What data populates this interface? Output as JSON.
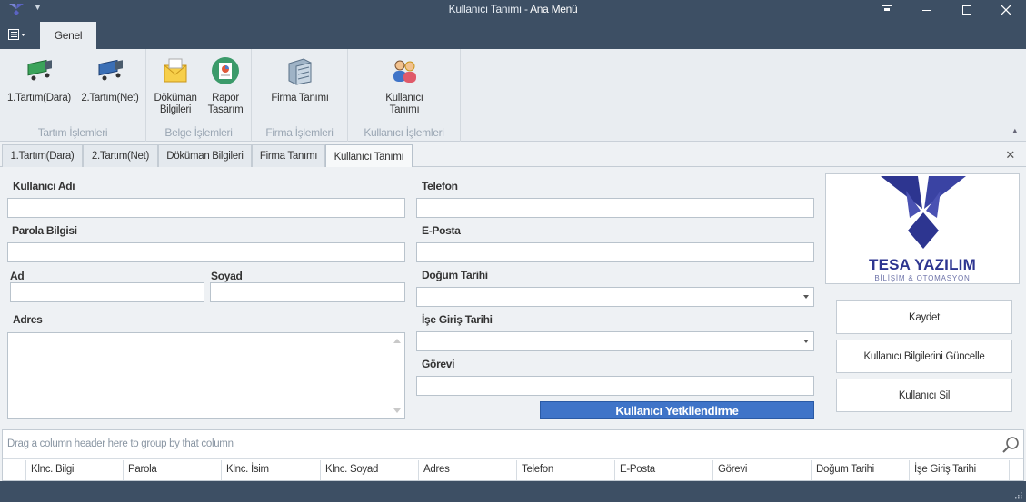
{
  "window": {
    "title_main": "Kullanıcı Tanımı",
    "title_sep": " - ",
    "title_app": "Ana Menü"
  },
  "ribbon": {
    "tab": "Genel",
    "groups": [
      {
        "name": "Tartım İşlemleri",
        "buttons": [
          {
            "label": "1.Tartım(Dara)",
            "icon": "truck-green-icon"
          },
          {
            "label": "2.Tartım(Net)",
            "icon": "truck-blue-icon"
          }
        ]
      },
      {
        "name": "Belge İşlemleri",
        "buttons": [
          {
            "label": "Döküman Bilgileri",
            "icon": "envelope-icon"
          },
          {
            "label": "Rapor Tasarım",
            "icon": "report-design-icon"
          }
        ]
      },
      {
        "name": "Firma İşlemleri",
        "buttons": [
          {
            "label": "Firma Tanımı",
            "icon": "building-icon"
          }
        ]
      },
      {
        "name": "Kullanıcı İşlemleri",
        "buttons": [
          {
            "label": "Kullanıcı Tanımı",
            "icon": "users-icon"
          }
        ]
      }
    ]
  },
  "doc_tabs": [
    "1.Tartım(Dara)",
    "2.Tartım(Net)",
    "Döküman Bilgileri",
    "Firma Tanımı",
    "Kullanıcı Tanımı"
  ],
  "active_doc_tab": "Kullanıcı Tanımı",
  "form": {
    "username_label": "Kullanıcı Adı",
    "password_label": "Parola Bilgisi",
    "name_label": "Ad",
    "surname_label": "Soyad",
    "address_label": "Adres",
    "phone_label": "Telefon",
    "email_label": "E-Posta",
    "birthdate_label": "Doğum Tarihi",
    "hire_date_label": "İşe Giriş Tarihi",
    "position_label": "Görevi",
    "username": "",
    "password": "",
    "name": "",
    "surname": "",
    "address": "",
    "phone": "",
    "email": "",
    "birthdate": "",
    "hire_date": "",
    "position": ""
  },
  "logo": {
    "brand": "TESA YAZILIM",
    "tagline": "BİLİŞİM & OTOMASYON"
  },
  "actions": {
    "save": "Kaydet",
    "update": "Kullanıcı Bilgilerini Güncelle",
    "delete": "Kullanıcı Sil",
    "authorize": "Kullanıcı Yetkilendirme"
  },
  "grid": {
    "group_hint": "Drag a column header here to group by that column",
    "columns": [
      "Klnc. Bilgi",
      "Parola",
      "Klnc. İsim",
      "Klnc. Soyad",
      "Adres",
      "Telefon",
      "E-Posta",
      "Görevi",
      "Doğum Tarihi",
      "İşe Giriş Tarihi"
    ]
  },
  "colors": {
    "titlebar": "#3d4f64",
    "ribbon": "#e9edf1",
    "accent_button": "#3f74c8",
    "brand": "#2d3590"
  }
}
